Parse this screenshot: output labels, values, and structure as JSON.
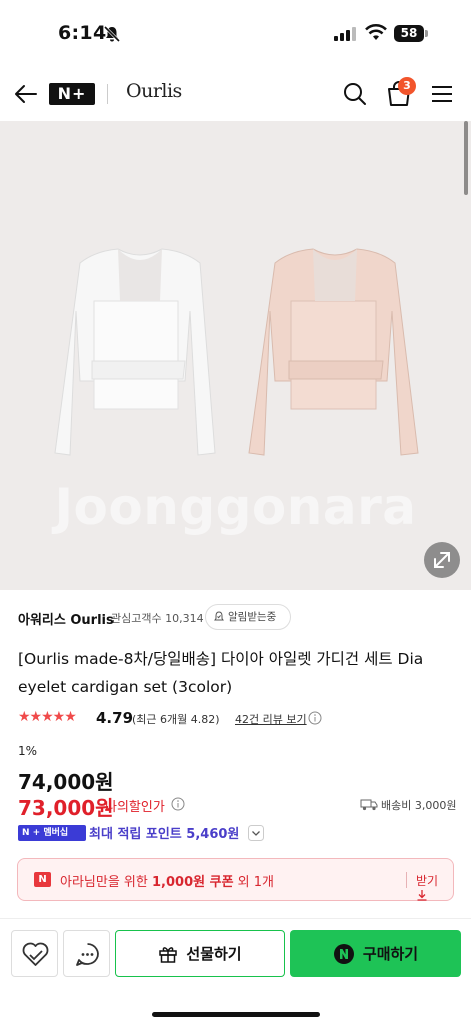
{
  "status_bar": {
    "time": "6:14",
    "battery": "58"
  },
  "header": {
    "logo": "N+",
    "store_logo": "Ourlis",
    "cart_count": "3"
  },
  "hero": {
    "watermark": "Joonggonara"
  },
  "store": {
    "name": "아워리스 Ourlis",
    "followers": "관심고객수 10,314",
    "alarm_label": "알림받는중"
  },
  "product": {
    "title": "[Ourlis made-8차/당일배송] 다이아 아일렛 가디건 세트 Dia eyelet cardigan set (3color)",
    "stars": "★★★★★",
    "rating": "4.79",
    "recent": "(최근 6개월 4.82)",
    "reviews": "42건 리뷰 보기"
  },
  "price": {
    "discount_rate": "1%",
    "original": "74,000원",
    "sale": "73,000원",
    "sale_label": "나의할인가",
    "shipping": "배송비 3,000원"
  },
  "points": {
    "badge": "N + 멤버십",
    "text": "최대 적립 포인트 5,460원"
  },
  "coupon": {
    "icon": "N",
    "prefix": "아라님만을 위한 ",
    "amount": "1,000원 쿠폰",
    "suffix": " 외 1개",
    "receive": "받기"
  },
  "bottom": {
    "gift_label": "선물하기",
    "buy_label": "구매하기"
  },
  "colors": {
    "naver_green": "#1ec356",
    "sale_red": "#e0202a",
    "membership_purple": "#3b3bd6"
  }
}
